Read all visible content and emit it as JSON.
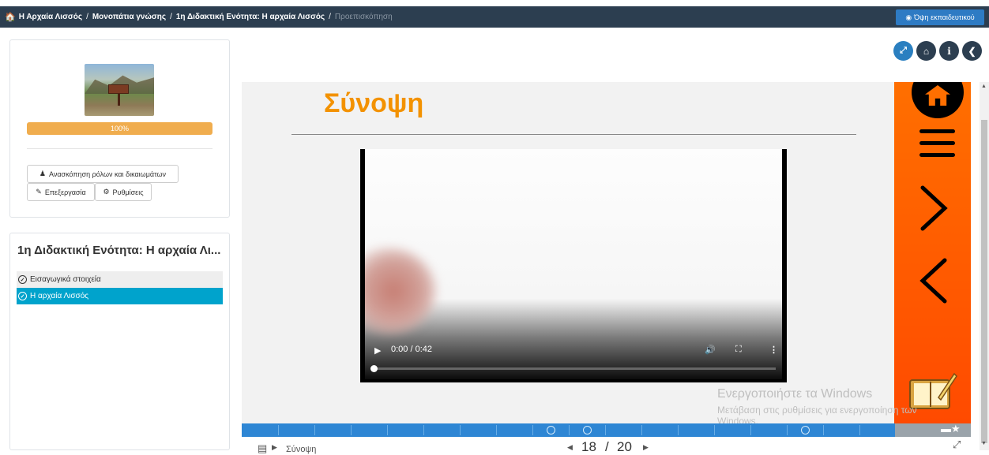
{
  "breadcrumb": {
    "items": [
      "Η Αρχαία Λισσός",
      "Μονοπάτια γνώσης",
      "1η Διδακτική Ενότητα: Η αρχαία Λισσός"
    ],
    "current": "Προεπισκόπηση"
  },
  "header": {
    "teacher_view_label": "Όψη εκπαιδευτικού"
  },
  "toolbar": {
    "expand_icon": "expand-icon",
    "home_icon": "home-icon",
    "info_icon": "info-icon",
    "back_icon": "chevron-left-icon"
  },
  "module": {
    "progress_percent": 100,
    "progress_label": "100%",
    "review_roles_label": "Ανασκόπηση ρόλων και δικαιωμάτων",
    "edit_label": "Επεξεργασία",
    "settings_label": "Ρυθμίσεις"
  },
  "unit": {
    "title": "1η Διδακτική Ενότητα: Η αρχαία Λι...",
    "items": [
      {
        "label": "Εισαγωγικά στοιχεία",
        "active": false
      },
      {
        "label": "Η αρχαία Λισσός",
        "active": true
      }
    ]
  },
  "slide": {
    "title": "Σύνοψη",
    "video": {
      "time": "0:00 / 0:42"
    }
  },
  "watermark": {
    "line1": "Ενεργοποιήστε τα Windows",
    "line2": "Μετάβαση στις ρυθμίσεις για ενεργοποίηση των",
    "line3": "Windows."
  },
  "footer": {
    "page_current": "18",
    "page_sep": "/",
    "page_total": "20",
    "section_label": "Σύνοψη"
  },
  "colors": {
    "accent": "#f39200",
    "navbar": "#2c3e50",
    "active_item": "#00a3cc",
    "teacher_btn": "#2e7bc4"
  }
}
